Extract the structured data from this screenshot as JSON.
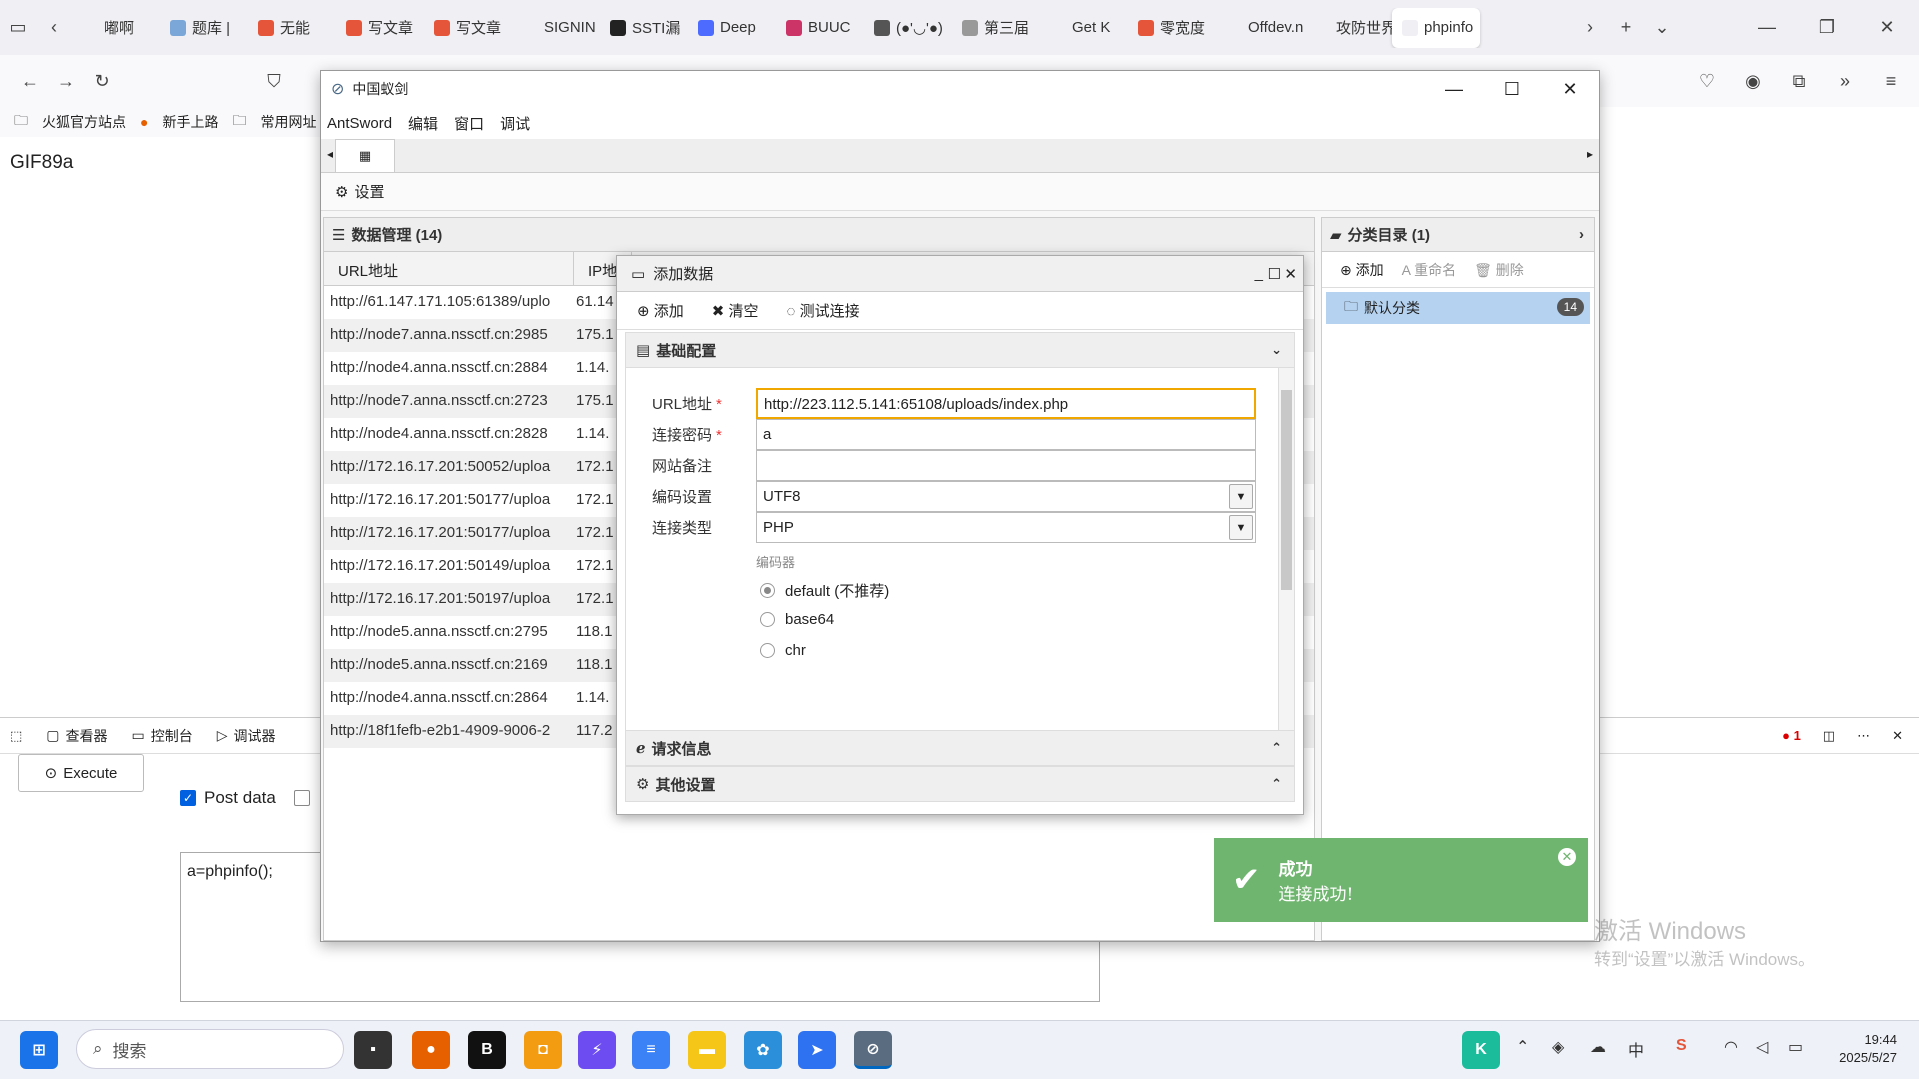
{
  "browser": {
    "tabs": [
      {
        "label": "嘟啊",
        "color": "#f0f0f4"
      },
      {
        "label": "题库 |",
        "color": "#7aa7d8"
      },
      {
        "label": "无能",
        "color": "#e5553a"
      },
      {
        "label": "写文章",
        "color": "#e5553a"
      },
      {
        "label": "写文章",
        "color": "#e5553a"
      },
      {
        "label": "SIGNIN",
        "color": "#f0f0f4"
      },
      {
        "label": "SSTI漏",
        "color": "#222"
      },
      {
        "label": "Deep",
        "color": "#4d6bfe"
      },
      {
        "label": "BUUC",
        "color": "#cc3366"
      },
      {
        "label": "(●'◡'●)",
        "color": "#555"
      },
      {
        "label": "第三届",
        "color": "#999"
      },
      {
        "label": "Get K",
        "color": "#f0f0f4"
      },
      {
        "label": "零宽度",
        "color": "#e5553a"
      },
      {
        "label": "Offdev.ne",
        "color": "#f0f0f4"
      },
      {
        "label": "攻防世界",
        "color": "#f0f0f4"
      },
      {
        "label": "phpinfo",
        "color": "#f0f0f4",
        "active": true
      }
    ],
    "bookmarks": [
      "火狐官方站点",
      "新手上路",
      "常用网址"
    ]
  },
  "page": {
    "content": "GIF89a"
  },
  "devtools": {
    "tabs": [
      "查看器",
      "控制台",
      "调试器"
    ],
    "error_count": "1",
    "execute_label": "Execute",
    "post_data_label": "Post data",
    "post_data_checked": true,
    "post_body": "a=phpinfo();"
  },
  "antsword": {
    "title": "中国蚁剑",
    "menu": [
      "AntSword",
      "编辑",
      "窗口",
      "调试"
    ],
    "settings_label": "设置",
    "data_panel_title": "数据管理 (14)",
    "columns": [
      "URL地址",
      "IP地"
    ],
    "rows": [
      {
        "url": "http://61.147.171.105:61389/uplo",
        "ip": "61.14"
      },
      {
        "url": "http://node7.anna.nssctf.cn:2985",
        "ip": "175.1"
      },
      {
        "url": "http://node4.anna.nssctf.cn:2884",
        "ip": "1.14."
      },
      {
        "url": "http://node7.anna.nssctf.cn:2723",
        "ip": "175.1"
      },
      {
        "url": "http://node4.anna.nssctf.cn:2828",
        "ip": "1.14."
      },
      {
        "url": "http://172.16.17.201:50052/uploa",
        "ip": "172.1"
      },
      {
        "url": "http://172.16.17.201:50177/uploa",
        "ip": "172.1"
      },
      {
        "url": "http://172.16.17.201:50177/uploa",
        "ip": "172.1"
      },
      {
        "url": "http://172.16.17.201:50149/uploa",
        "ip": "172.1"
      },
      {
        "url": "http://172.16.17.201:50197/uploa",
        "ip": "172.1"
      },
      {
        "url": "http://node5.anna.nssctf.cn:2795",
        "ip": "118.1"
      },
      {
        "url": "http://node5.anna.nssctf.cn:2169",
        "ip": "118.1"
      },
      {
        "url": "http://node4.anna.nssctf.cn:2864",
        "ip": "1.14."
      },
      {
        "url": "http://18f1fefb-e2b1-4909-9006-2",
        "ip": "117.2"
      }
    ],
    "category_title": "分类目录 (1)",
    "category_tools": [
      "添加",
      "重命名",
      "删除"
    ],
    "category_item": "默认分类",
    "category_count": "14"
  },
  "dialog": {
    "title": "添加数据",
    "tools": [
      "添加",
      "清空",
      "测试连接"
    ],
    "section_basic": "基础配置",
    "section_request": "请求信息",
    "section_other": "其他设置",
    "url_label": "URL地址",
    "url_value": "http://223.112.5.141:65108/uploads/index.php",
    "password_label": "连接密码",
    "password_value": "a",
    "note_label": "网站备注",
    "note_value": "",
    "encoding_label": "编码设置",
    "encoding_value": "UTF8",
    "type_label": "连接类型",
    "type_value": "PHP",
    "encoder_label": "编码器",
    "encoders": [
      {
        "label": "default (不推荐)",
        "selected": true
      },
      {
        "label": "base64",
        "selected": false
      },
      {
        "label": "chr",
        "selected": false
      }
    ]
  },
  "toast": {
    "title": "成功",
    "message": "连接成功!"
  },
  "watermark": {
    "line1": "激活 Windows",
    "line2": "转到“设置”以激活 Windows。"
  },
  "taskbar": {
    "search_placeholder": "搜索",
    "ime_label": "中",
    "time": "19:44",
    "date": "2025/5/27"
  },
  "colors": {
    "toast_bg": "#6fb46f",
    "selected_category": "#b5d2f0",
    "focus_border": "#f0a800",
    "required": "#e33333"
  }
}
